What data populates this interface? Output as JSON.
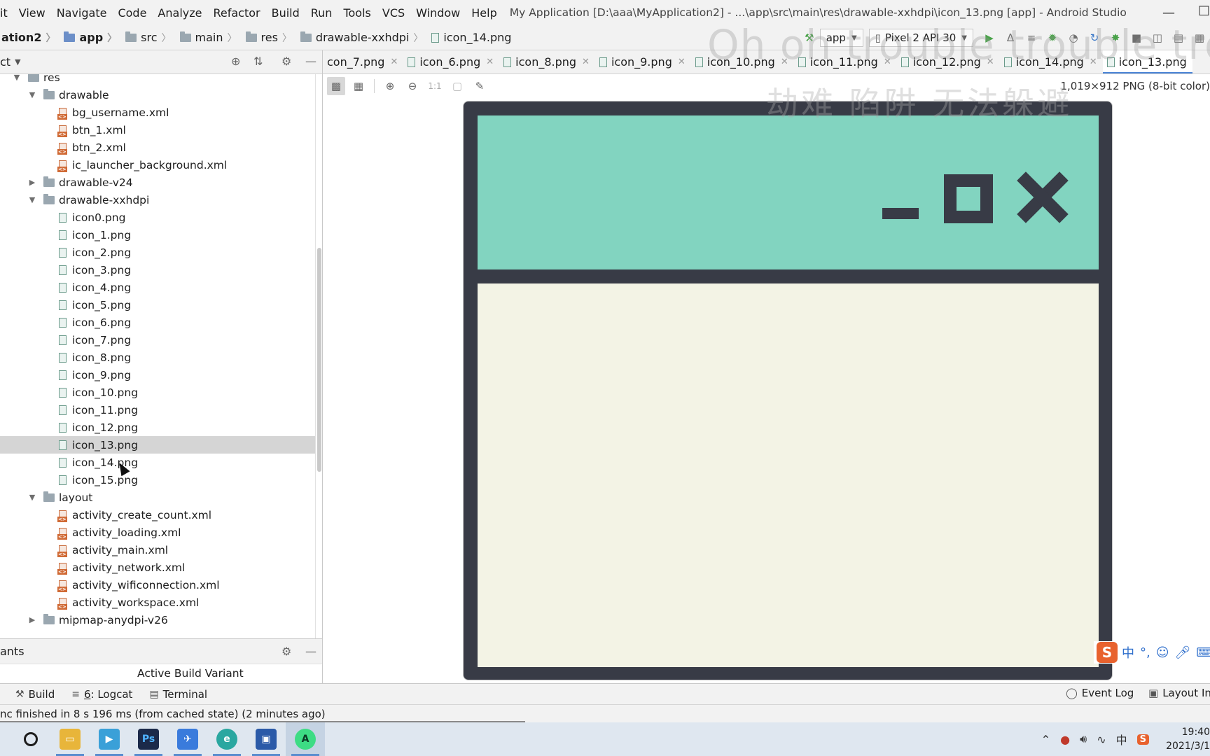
{
  "menubar": {
    "items": [
      "it",
      "View",
      "Navigate",
      "Code",
      "Analyze",
      "Refactor",
      "Build",
      "Run",
      "Tools",
      "VCS",
      "Window",
      "Help"
    ],
    "window_title": "My Application [D:\\aaa\\MyApplication2] - ...\\app\\src\\main\\res\\drawable-xxhdpi\\icon_13.png [app] - Android Studio"
  },
  "breadcrumb": {
    "items": [
      "ation2",
      "app",
      "src",
      "main",
      "res",
      "drawable-xxhdpi",
      "icon_14.png"
    ]
  },
  "run_toolbar": {
    "module": "app",
    "device": "Pixel 2 API 30"
  },
  "project_panel": {
    "title": "ct",
    "tree": [
      {
        "label": "res",
        "depth": 0,
        "kind": "folder",
        "arrow": "open"
      },
      {
        "label": "drawable",
        "depth": 1,
        "kind": "folder",
        "arrow": "open"
      },
      {
        "label": "bg_username.xml",
        "depth": 2,
        "kind": "xml"
      },
      {
        "label": "btn_1.xml",
        "depth": 2,
        "kind": "xml"
      },
      {
        "label": "btn_2.xml",
        "depth": 2,
        "kind": "xml"
      },
      {
        "label": "ic_launcher_background.xml",
        "depth": 2,
        "kind": "xml"
      },
      {
        "label": "drawable-v24",
        "depth": 1,
        "kind": "folder",
        "arrow": "closed"
      },
      {
        "label": "drawable-xxhdpi",
        "depth": 1,
        "kind": "folder",
        "arrow": "open"
      },
      {
        "label": "icon0.png",
        "depth": 2,
        "kind": "png"
      },
      {
        "label": "icon_1.png",
        "depth": 2,
        "kind": "png"
      },
      {
        "label": "icon_2.png",
        "depth": 2,
        "kind": "png"
      },
      {
        "label": "icon_3.png",
        "depth": 2,
        "kind": "png"
      },
      {
        "label": "icon_4.png",
        "depth": 2,
        "kind": "png"
      },
      {
        "label": "icon_5.png",
        "depth": 2,
        "kind": "png"
      },
      {
        "label": "icon_6.png",
        "depth": 2,
        "kind": "png"
      },
      {
        "label": "icon_7.png",
        "depth": 2,
        "kind": "png"
      },
      {
        "label": "icon_8.png",
        "depth": 2,
        "kind": "png"
      },
      {
        "label": "icon_9.png",
        "depth": 2,
        "kind": "png"
      },
      {
        "label": "icon_10.png",
        "depth": 2,
        "kind": "png"
      },
      {
        "label": "icon_11.png",
        "depth": 2,
        "kind": "png"
      },
      {
        "label": "icon_12.png",
        "depth": 2,
        "kind": "png"
      },
      {
        "label": "icon_13.png",
        "depth": 2,
        "kind": "png",
        "selected": true
      },
      {
        "label": "icon_14.png",
        "depth": 2,
        "kind": "png"
      },
      {
        "label": "icon_15.png",
        "depth": 2,
        "kind": "png"
      },
      {
        "label": "layout",
        "depth": 1,
        "kind": "folder",
        "arrow": "open"
      },
      {
        "label": "activity_create_count.xml",
        "depth": 2,
        "kind": "xml"
      },
      {
        "label": "activity_loading.xml",
        "depth": 2,
        "kind": "xml"
      },
      {
        "label": "activity_main.xml",
        "depth": 2,
        "kind": "xml"
      },
      {
        "label": "activity_network.xml",
        "depth": 2,
        "kind": "xml"
      },
      {
        "label": "activity_wificonnection.xml",
        "depth": 2,
        "kind": "xml"
      },
      {
        "label": "activity_workspace.xml",
        "depth": 2,
        "kind": "xml"
      },
      {
        "label": "mipmap-anydpi-v26",
        "depth": 1,
        "kind": "folder",
        "arrow": "closed"
      }
    ]
  },
  "build_variants": {
    "title": "ants",
    "column_header": "Active Build Variant"
  },
  "editor_tabs": [
    {
      "label": "con_7.png",
      "active": false
    },
    {
      "label": "icon_6.png",
      "active": false
    },
    {
      "label": "icon_8.png",
      "active": false
    },
    {
      "label": "icon_9.png",
      "active": false
    },
    {
      "label": "icon_10.png",
      "active": false
    },
    {
      "label": "icon_11.png",
      "active": false
    },
    {
      "label": "icon_12.png",
      "active": false
    },
    {
      "label": "icon_14.png",
      "active": false
    },
    {
      "label": "icon_13.png",
      "active": true
    }
  ],
  "viewer": {
    "image_info": "1,019×912 PNG (8-bit color)",
    "zoom_actual_label": "1:1"
  },
  "image_colors": {
    "frame": "#383b46",
    "titlebar": "#82d4c0",
    "content": "#f3f3e5"
  },
  "watermark": {
    "line1": "Oh oh trouble trouble trout",
    "line2": "劫难 陷阱 无法躲避"
  },
  "ime_bar": {
    "logo": "S",
    "mode": "中",
    "punct": "°,"
  },
  "bottom_tools": {
    "build": "Build",
    "logcat_num": "6",
    "logcat": ": Logcat",
    "terminal": "Terminal",
    "event_log": "Event Log",
    "layout_inspector": "Layout Ins"
  },
  "status": {
    "message": "nc finished in 8 s 196 ms (from cached state) (2 minutes ago)"
  },
  "taskbar": {
    "ime_lang": "中",
    "time": "19:40",
    "date": "2021/3/1"
  },
  "colors": {
    "accent": "#4a84d6",
    "selected_row": "#d5d5d5"
  }
}
